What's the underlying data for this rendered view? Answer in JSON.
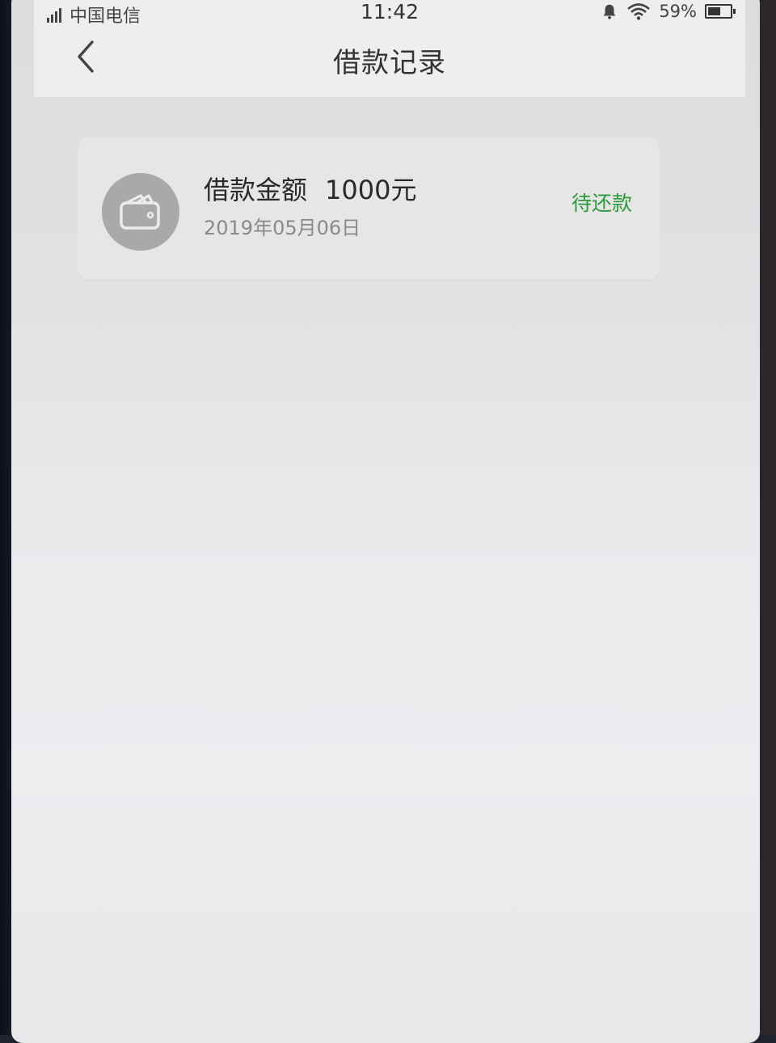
{
  "status_bar": {
    "carrier": "中国电信",
    "time": "11:42",
    "battery": "59%",
    "battery_level": 0.59
  },
  "header": {
    "title": "借款记录"
  },
  "records": [
    {
      "amount_label": "借款金额",
      "amount_value": "1000元",
      "date": "2019年05月06日",
      "status": "待还款",
      "status_color": "#2f9a3c",
      "icon": "wallet-icon"
    }
  ]
}
